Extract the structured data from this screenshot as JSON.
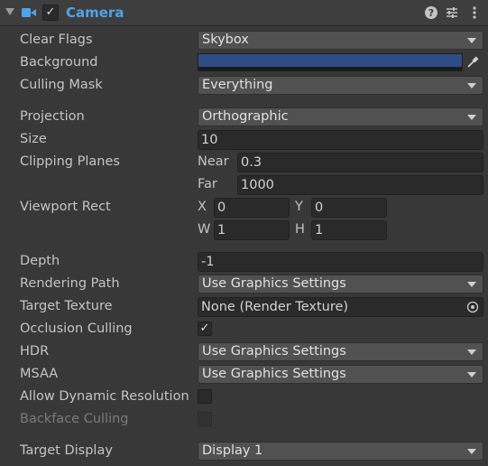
{
  "header": {
    "title": "Camera"
  },
  "rows": {
    "clear_flags": {
      "label": "Clear Flags",
      "value": "Skybox"
    },
    "background": {
      "label": "Background",
      "color": "#2e4d85"
    },
    "culling_mask": {
      "label": "Culling Mask",
      "value": "Everything"
    },
    "projection": {
      "label": "Projection",
      "value": "Orthographic"
    },
    "size": {
      "label": "Size",
      "value": "10"
    },
    "clipping_planes": {
      "label": "Clipping Planes",
      "near_label": "Near",
      "near": "0.3",
      "far_label": "Far",
      "far": "1000"
    },
    "viewport_rect": {
      "label": "Viewport Rect",
      "x_label": "X",
      "x": "0",
      "y_label": "Y",
      "y": "0",
      "w_label": "W",
      "w": "1",
      "h_label": "H",
      "h": "1"
    },
    "depth": {
      "label": "Depth",
      "value": "-1"
    },
    "rendering_path": {
      "label": "Rendering Path",
      "value": "Use Graphics Settings"
    },
    "target_texture": {
      "label": "Target Texture",
      "value": "None (Render Texture)"
    },
    "occlusion_culling": {
      "label": "Occlusion Culling",
      "checked": true
    },
    "hdr": {
      "label": "HDR",
      "value": "Use Graphics Settings"
    },
    "msaa": {
      "label": "MSAA",
      "value": "Use Graphics Settings"
    },
    "allow_dynamic_resolution": {
      "label": "Allow Dynamic Resolution",
      "checked": false
    },
    "backface_culling": {
      "label": "Backface Culling",
      "checked": false,
      "disabled": true
    },
    "target_display": {
      "label": "Target Display",
      "value": "Display 1"
    }
  },
  "icons": {
    "component": "camera-icon",
    "help": "help-icon",
    "presets": "presets-icon",
    "menu": "kebab-menu-icon",
    "picker": "eyedropper-icon",
    "object_picker": "object-picker-icon"
  }
}
